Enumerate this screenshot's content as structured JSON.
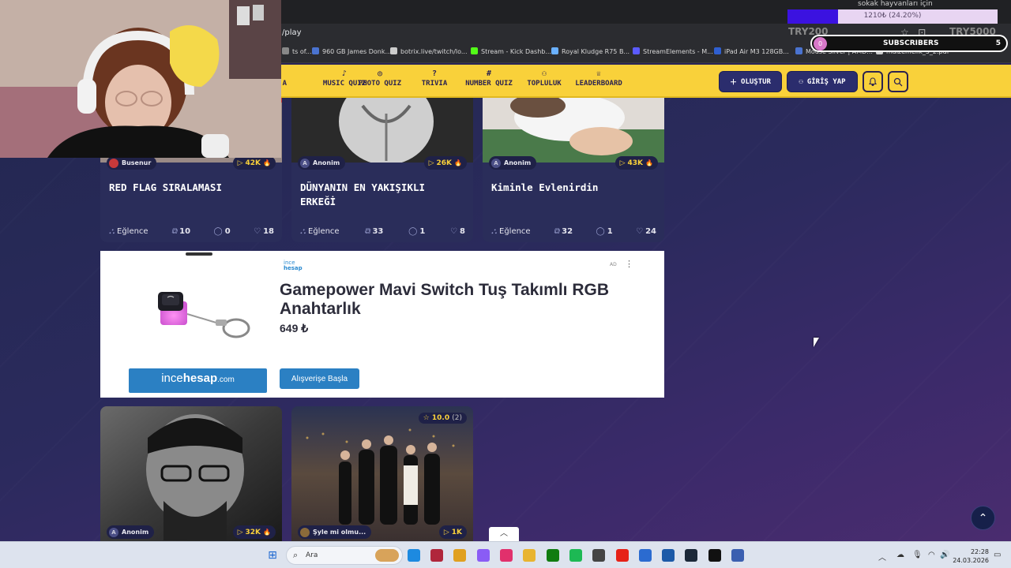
{
  "browser": {
    "url": "/play",
    "bookmarks": [
      {
        "label": "ts of...",
        "color": "#888888"
      },
      {
        "label": "960 GB James Donk...",
        "color": "#4a73d0"
      },
      {
        "label": "botrix.live/twitch/lo...",
        "color": "#cccccc"
      },
      {
        "label": "Stream - Kick Dashb...",
        "color": "#53fc18"
      },
      {
        "label": "Royal Kludge R75 B...",
        "color": "#6ab0ff"
      },
      {
        "label": "StreamElements - M...",
        "color": "#5b5bff"
      },
      {
        "label": "iPad Air M3 128GB...",
        "color": "#2f5fd0"
      },
      {
        "label": "Mouse Silver | AMD...",
        "color": "#4a73d0"
      },
      {
        "label": "malzemelik_5_2.pdf",
        "color": "#cccccc"
      }
    ]
  },
  "nav": {
    "items": [
      {
        "label": "A",
        "icon": "partial-icon"
      },
      {
        "label": "MUSIC QUIZ",
        "icon": "music-icon"
      },
      {
        "label": "PHOTO QUIZ",
        "icon": "camera-icon"
      },
      {
        "label": "TRIVIA",
        "icon": "question-icon"
      },
      {
        "label": "NUMBER QUIZ",
        "icon": "hash-icon"
      },
      {
        "label": "TOPLULUK",
        "icon": "users-icon"
      },
      {
        "label": "LEADERBOARD",
        "icon": "trophy-icon"
      }
    ],
    "create_label": "OLUŞTUR",
    "login_label": "GİRİŞ YAP"
  },
  "cards_top": [
    {
      "author": "Busenur",
      "author_initial": "",
      "plays": "42K",
      "title": "RED FLAG SIRALAMASI",
      "category": "Eğlence",
      "questions": "10",
      "comments": "0",
      "likes": "18"
    },
    {
      "author": "Anonim",
      "author_initial": "A",
      "plays": "26K",
      "title": "DÜNYANIN EN YAKIŞIKLI ERKEĞİ",
      "category": "Eğlence",
      "questions": "33",
      "comments": "1",
      "likes": "8"
    },
    {
      "author": "Anonim",
      "author_initial": "A",
      "plays": "43K",
      "title": "Kiminle Evlenirdin",
      "category": "Eğlence",
      "questions": "32",
      "comments": "1",
      "likes": "24"
    }
  ],
  "ad": {
    "brand_small_top": "ince",
    "brand_small_bottom": "hesap",
    "tag": "AD",
    "headline": "Gamepower Mavi Switch Tuş Takımlı RGB Anahtarlık",
    "price": "649 ₺",
    "brand_name_prefix": "ince",
    "brand_name_bold": "hesap",
    "brand_name_suffix": ".com",
    "cta": "Alışverişe Başla"
  },
  "cards_bottom": [
    {
      "author": "Anonim",
      "author_initial": "A",
      "plays": "32K"
    },
    {
      "author": "Şyle mi olmu...",
      "author_initial": "",
      "plays": "1K",
      "rating": "10.0",
      "rating_count": "(2)"
    }
  ],
  "overlay": {
    "goal_title": "sokak hayvanları için",
    "goal_text": "1210₺ (24.20%)",
    "goal_progress": 0.242,
    "goal_left": "TRY200",
    "goal_right": "TRY5000",
    "subs_badge": "0",
    "subs_label": "SUBSCRIBERS",
    "subs_count": "5"
  },
  "taskbar": {
    "search_label": "Ara",
    "time": "22:28",
    "date": "24.03.2026",
    "apps": [
      {
        "icon": "edge-icon",
        "color": "#1d8ae0"
      },
      {
        "icon": "app-icon",
        "color": "#b0263b"
      },
      {
        "icon": "chrome-icon",
        "color": "#e0a020"
      },
      {
        "icon": "messenger-icon",
        "color": "#8a5cf5"
      },
      {
        "icon": "instagram-icon",
        "color": "#e1306c"
      },
      {
        "icon": "folder-icon",
        "color": "#e8b430"
      },
      {
        "icon": "xbox-icon",
        "color": "#107c10"
      },
      {
        "icon": "spotify-icon",
        "color": "#1db954"
      },
      {
        "icon": "obs-icon",
        "color": "#444444"
      },
      {
        "icon": "youtube-icon",
        "color": "#e62117"
      },
      {
        "icon": "mail-icon",
        "color": "#2b6bd0"
      },
      {
        "icon": "notes-icon",
        "color": "#1c5aa8"
      },
      {
        "icon": "steam-icon",
        "color": "#1b2838"
      },
      {
        "icon": "tiktok-icon",
        "color": "#111111"
      },
      {
        "icon": "settings-icon",
        "color": "#3b5fb0"
      }
    ]
  }
}
